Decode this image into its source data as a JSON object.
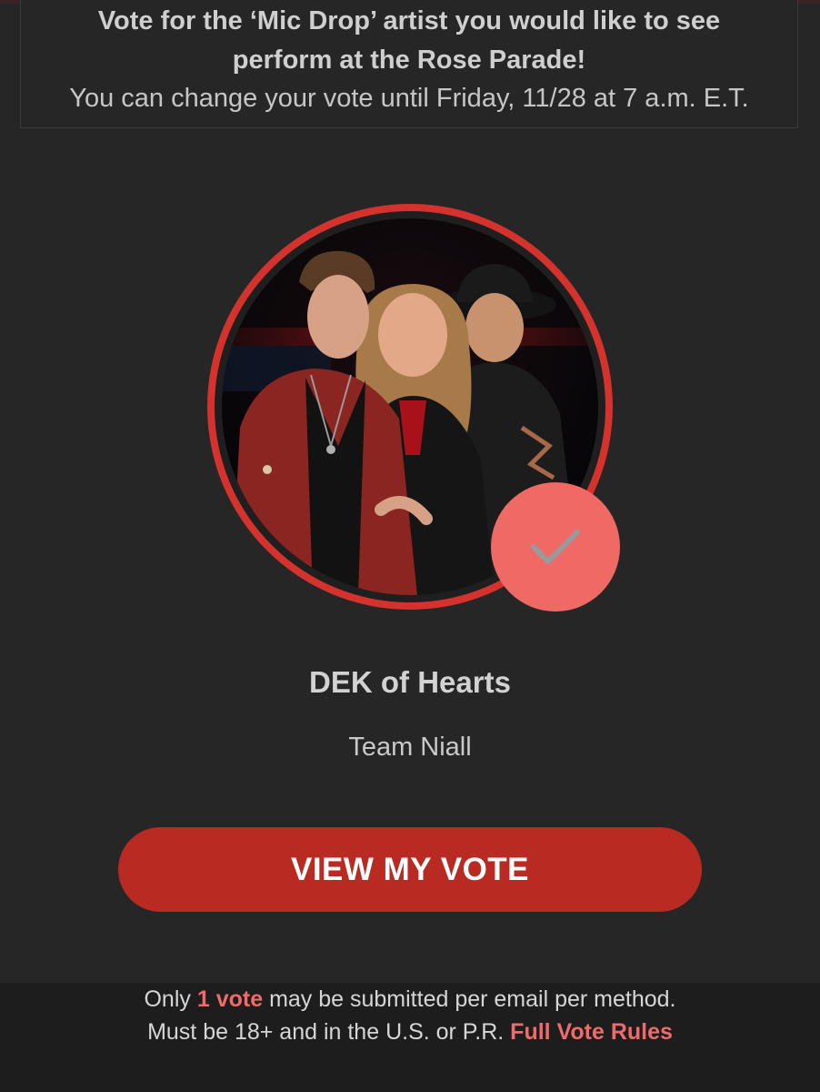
{
  "header": {
    "title_line1": "Vote for the ‘Mic Drop’ artist you would like to see",
    "title_line2": "perform at the Rose Parade!",
    "subtitle": "You can change your vote until Friday, 11/28 at 7 a.m. E.T."
  },
  "artist": {
    "name": "DEK of Hearts",
    "team": "Team Niall",
    "selected": true,
    "badge_icon": "check-icon"
  },
  "actions": {
    "view_vote_label": "VIEW MY VOTE"
  },
  "footer": {
    "line1_prefix": "Only",
    "line1_highlight": "1 vote",
    "line1_suffix": "may be submitted per email per method.",
    "line2_prefix": "Must be 18+ and in the U.S. or P.R.",
    "rules_link": "Full Vote Rules"
  },
  "colors": {
    "background": "#262626",
    "accent_red": "#d4322d",
    "button_red": "#b92a22",
    "badge_coral": "#ef6a64",
    "link_pink": "#ef6b6b"
  }
}
